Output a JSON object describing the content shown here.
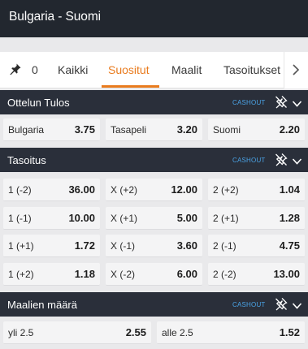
{
  "header": {
    "title": "Bulgaria - Suomi"
  },
  "tabs": {
    "pinned_count": "0",
    "items": [
      {
        "label": "Kaikki"
      },
      {
        "label": "Suositut"
      },
      {
        "label": "Maalit"
      },
      {
        "label": "Tasoitukset"
      }
    ],
    "active_index": 1,
    "accent_color": "#e97b1e"
  },
  "markets": {
    "ottelun_tulos": {
      "title": "Ottelun Tulos",
      "cashout": "CASHOUT",
      "outcomes": [
        {
          "name": "Bulgaria",
          "odds": "3.75"
        },
        {
          "name": "Tasapeli",
          "odds": "3.20"
        },
        {
          "name": "Suomi",
          "odds": "2.20"
        }
      ]
    },
    "tasoitus": {
      "title": "Tasoitus",
      "cashout": "CASHOUT",
      "rows": [
        [
          {
            "name": "1 (-2)",
            "odds": "36.00"
          },
          {
            "name": "X (+2)",
            "odds": "12.00"
          },
          {
            "name": "2 (+2)",
            "odds": "1.04"
          }
        ],
        [
          {
            "name": "1 (-1)",
            "odds": "10.00"
          },
          {
            "name": "X (+1)",
            "odds": "5.00"
          },
          {
            "name": "2 (+1)",
            "odds": "1.28"
          }
        ],
        [
          {
            "name": "1 (+1)",
            "odds": "1.72"
          },
          {
            "name": "X (-1)",
            "odds": "3.60"
          },
          {
            "name": "2 (-1)",
            "odds": "4.75"
          }
        ],
        [
          {
            "name": "1 (+2)",
            "odds": "1.18"
          },
          {
            "name": "X (-2)",
            "odds": "6.00"
          },
          {
            "name": "2 (-2)",
            "odds": "13.00"
          }
        ]
      ]
    },
    "maalien_maara": {
      "title": "Maalien määrä",
      "cashout": "CASHOUT",
      "outcomes": [
        {
          "name": "yli 2.5",
          "odds": "2.55"
        },
        {
          "name": "alle 2.5",
          "odds": "1.52"
        }
      ]
    }
  },
  "icons": {
    "pin": "pin-icon",
    "tabs_next": "chevron-right-icon",
    "market_tools": "pin-off-icon",
    "market_collapse": "chevron-down-icon"
  },
  "colors": {
    "header_bg": "#22272f",
    "section_bg": "#2a2f3a",
    "cashout": "#4aa3e6",
    "cell_bg": "#f4f4f5"
  }
}
